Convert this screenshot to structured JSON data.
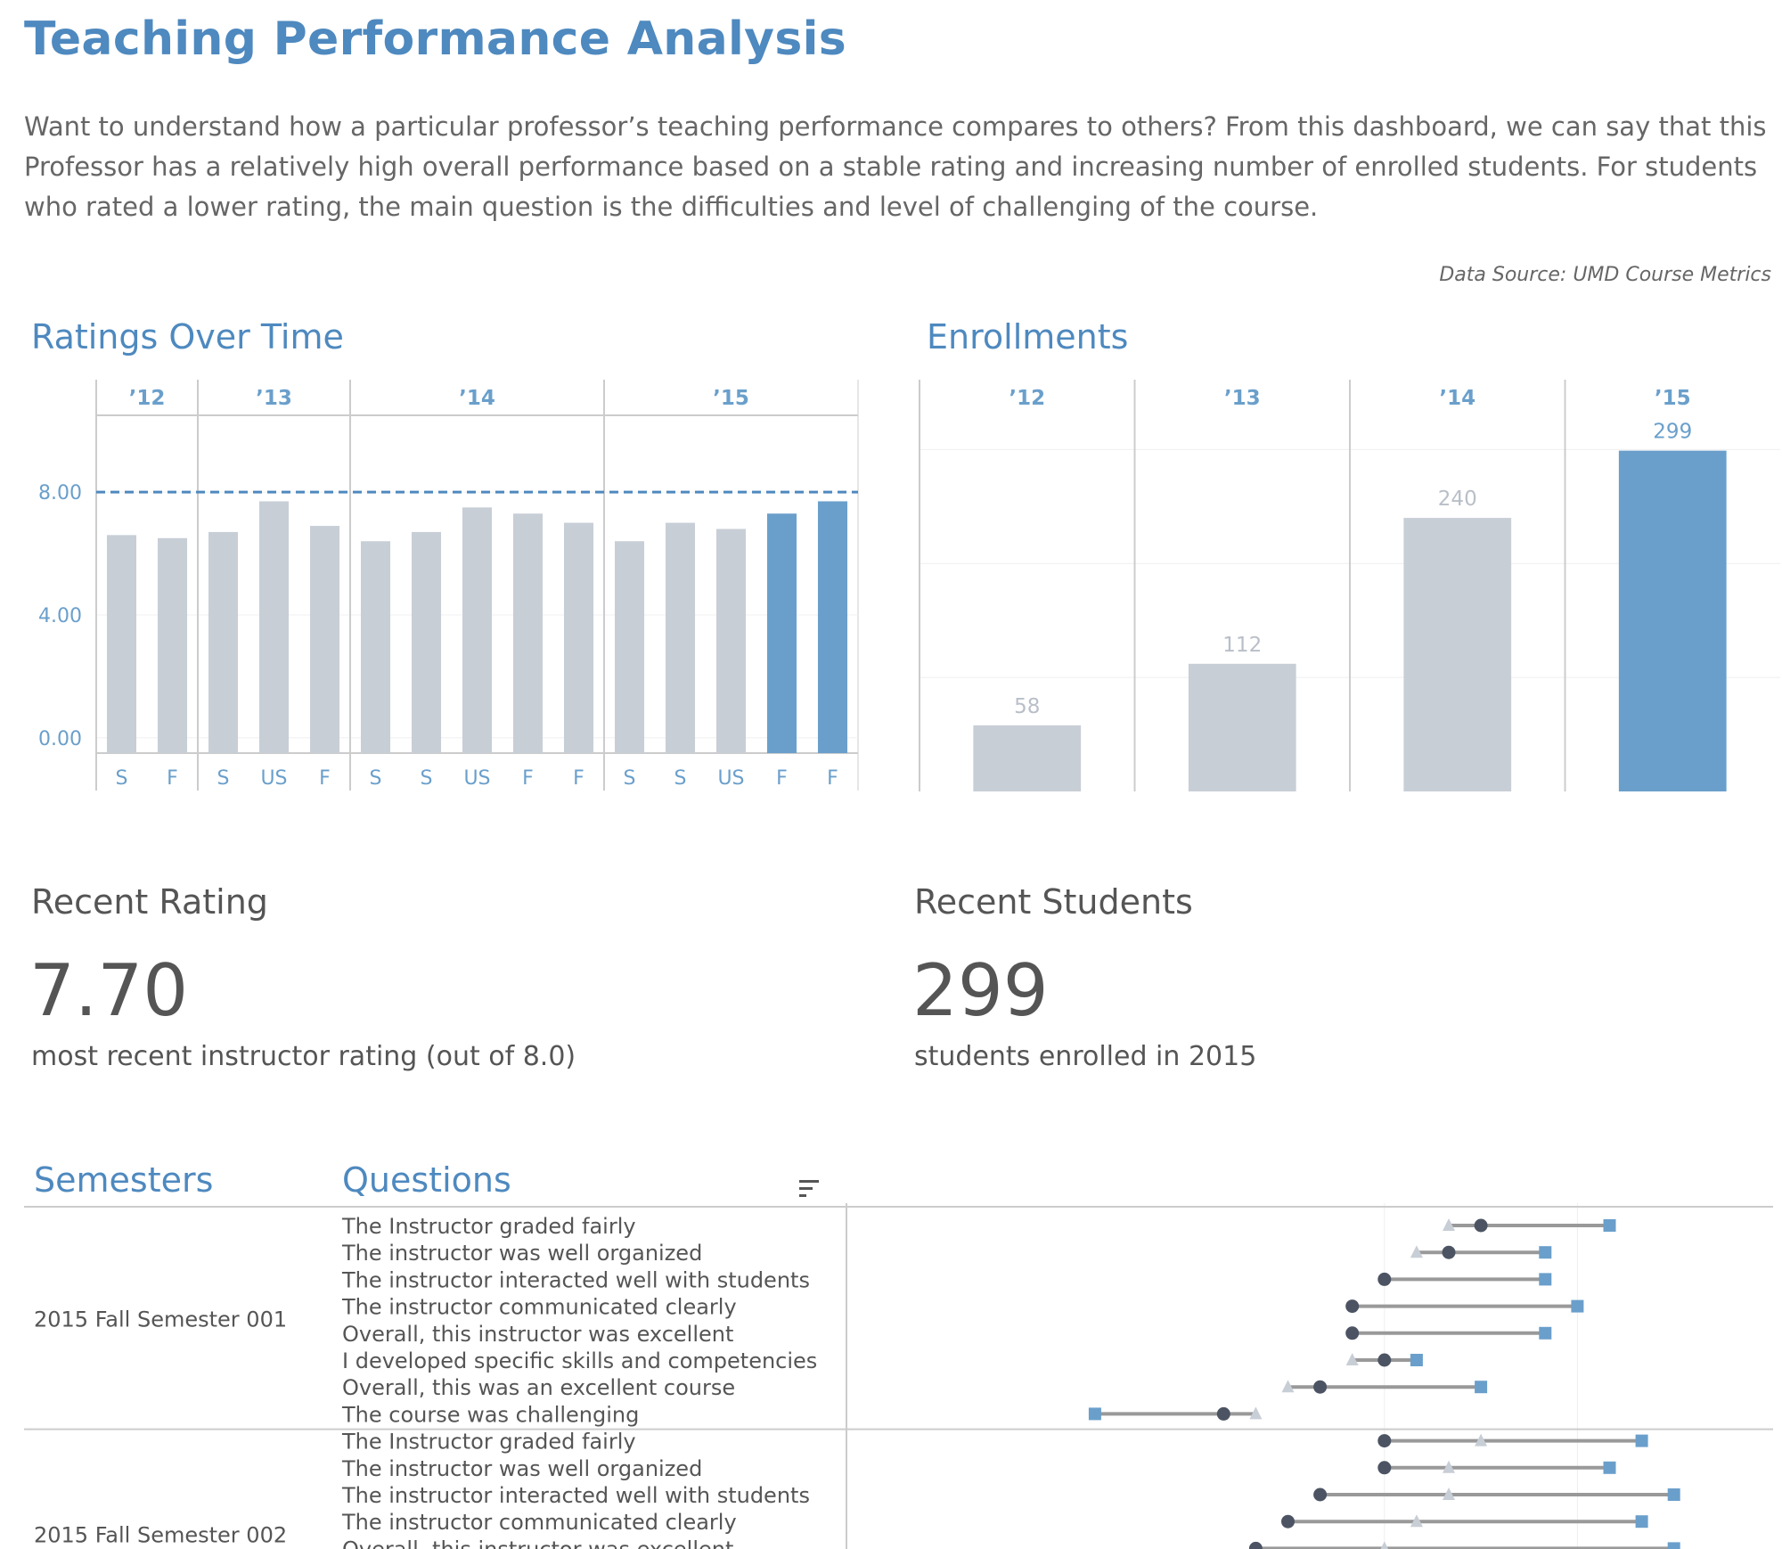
{
  "header": {
    "title": "Teaching Performance Analysis",
    "intro": "Want to understand how a particular professor’s teaching performance compares to others? From this dashboard, we can say that this Professor has a relatively high overall performance based on a stable rating and increasing number of enrolled students. For students who rated a lower rating, the main question is the difficulties and level of challenging of the course.",
    "source": "Data Source: UMD Course Metrics"
  },
  "colors": {
    "accent": "#6a9fcb",
    "title_blue": "#4e89bf",
    "bar_grey": "#c8ced6",
    "dot_dark": "#4c5463",
    "triangle_grey": "#c8ced6",
    "line_grey": "#999999"
  },
  "sections": {
    "ratings_title": "Ratings Over Time",
    "enrollments_title": "Enrollments",
    "semesters_title": "Semesters",
    "questions_title": "Questions"
  },
  "kpis": {
    "rating": {
      "title": "Recent Rating",
      "value": "7.70",
      "caption": "most  recent instructor rating (out of 8.0)"
    },
    "students": {
      "title": "Recent Students",
      "value": "299",
      "caption": "students enrolled in 2015"
    }
  },
  "chart_data": [
    {
      "type": "bar",
      "title": "Ratings Over Time",
      "years": [
        {
          "label": "’12",
          "semesters": [
            "S",
            "F"
          ]
        },
        {
          "label": "’13",
          "semesters": [
            "S",
            "US",
            "F"
          ]
        },
        {
          "label": "’14",
          "semesters": [
            "S",
            "S",
            "US",
            "F",
            "F"
          ]
        },
        {
          "label": "’15",
          "semesters": [
            "S",
            "S",
            "US",
            "F",
            "F"
          ]
        }
      ],
      "values": [
        6.6,
        6.5,
        6.7,
        7.7,
        6.9,
        6.4,
        6.7,
        7.5,
        7.3,
        7.0,
        6.4,
        7.0,
        6.8,
        7.3,
        7.7
      ],
      "highlighted": [
        false,
        false,
        false,
        false,
        false,
        false,
        false,
        false,
        false,
        false,
        false,
        false,
        false,
        true,
        true
      ],
      "reference_line": 8.0,
      "yticks": [
        "8.00",
        "4.00",
        "0.00"
      ],
      "ylim": [
        -0.5,
        10.5
      ]
    },
    {
      "type": "bar",
      "title": "Enrollments",
      "categories": [
        "’12",
        "’13",
        "’14",
        "’15"
      ],
      "values": [
        58,
        112,
        240,
        299
      ],
      "labels": [
        "58",
        "112",
        "240",
        "299"
      ],
      "highlighted": [
        false,
        false,
        false,
        true
      ],
      "ylim": [
        0,
        330
      ]
    },
    {
      "type": "scatter",
      "title": "Semesters / Questions",
      "legend": "none",
      "xlim": [
        0,
        10
      ],
      "groups": [
        {
          "semester": "2015 Fall Semester 001",
          "rows": [
            {
              "question": "The Instructor graded fairly",
              "dot": 5.5,
              "triangle": 5.0,
              "square": 7.5
            },
            {
              "question": "The instructor was well organized",
              "dot": 5.0,
              "triangle": 4.5,
              "square": 6.5
            },
            {
              "question": "The instructor interacted well with students",
              "dot": 4.0,
              "triangle": null,
              "square": 6.5
            },
            {
              "question": "The instructor communicated clearly",
              "dot": 3.5,
              "triangle": null,
              "square": 7.0
            },
            {
              "question": "Overall, this instructor was excellent",
              "dot": 3.5,
              "triangle": null,
              "square": 6.5
            },
            {
              "question": "I developed specific skills and competencies",
              "dot": 4.0,
              "triangle": 3.5,
              "square": 4.5
            },
            {
              "question": "Overall, this was an excellent course",
              "dot": 3.0,
              "triangle": 2.5,
              "square": 5.5
            },
            {
              "question": "The course was challenging",
              "dot": 1.5,
              "triangle": 2.0,
              "square": -0.5
            }
          ]
        },
        {
          "semester": "2015 Fall Semester 002",
          "rows": [
            {
              "question": "The Instructor graded fairly",
              "dot": 4.0,
              "triangle": 5.5,
              "square": 8.0
            },
            {
              "question": "The instructor was well organized",
              "dot": 4.0,
              "triangle": 5.0,
              "square": 7.5
            },
            {
              "question": "The instructor interacted well with students",
              "dot": 3.0,
              "triangle": 5.0,
              "square": 8.5
            },
            {
              "question": "The instructor communicated clearly",
              "dot": 2.5,
              "triangle": 4.5,
              "square": 8.0
            },
            {
              "question": "Overall, this instructor was excellent",
              "dot": 2.0,
              "triangle": 4.0,
              "square": 8.5
            }
          ]
        }
      ]
    }
  ]
}
